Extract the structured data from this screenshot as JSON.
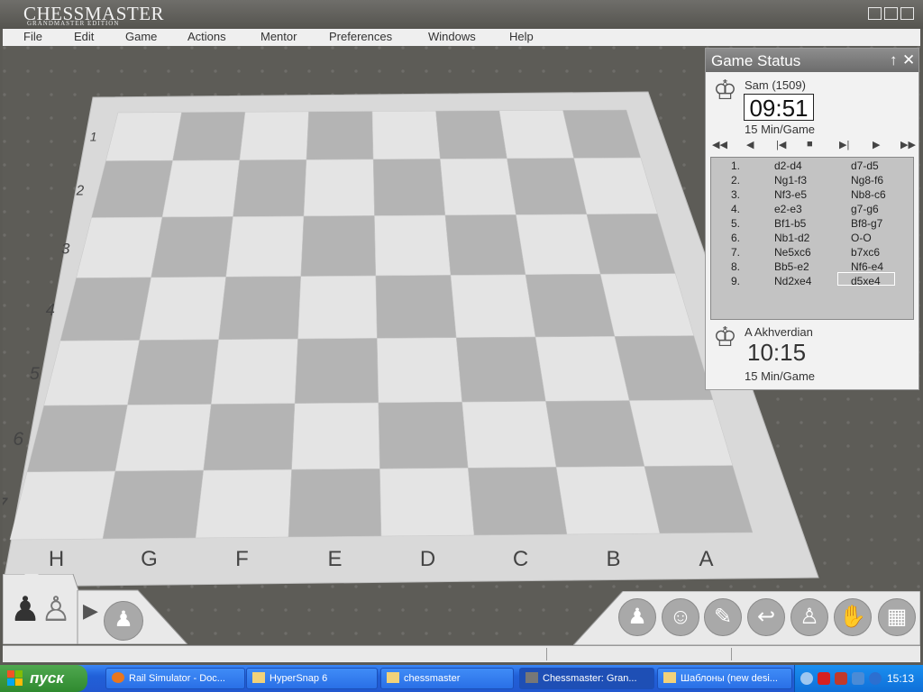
{
  "app": {
    "title": "CHESSMASTER",
    "subtitle": "GRANDMASTER EDITION"
  },
  "window_buttons": [
    "minimize-icon",
    "restore-icon",
    "close-icon"
  ],
  "menu": [
    "File",
    "Edit",
    "Game",
    "Actions",
    "Mentor",
    "Preferences",
    "Windows",
    "Help"
  ],
  "board": {
    "ranks": [
      "1",
      "2",
      "3",
      "4",
      "5",
      "6",
      "7"
    ],
    "files": [
      "H",
      "G",
      "F",
      "E",
      "D",
      "C",
      "B",
      "A"
    ]
  },
  "game_status": {
    "title": "Game Status",
    "player_top": {
      "name": "Sam (1509)",
      "clock": "09:51",
      "time_control": "15 Min/Game"
    },
    "player_bottom": {
      "name": "A Akhverdian",
      "clock": "10:15",
      "time_control": "15 Min/Game"
    },
    "nav_icons": [
      "first-move-icon",
      "prev-move-icon",
      "step-back-icon",
      "stop-icon",
      "step-forward-icon",
      "next-move-icon",
      "last-move-icon"
    ],
    "moves": [
      {
        "num": "1.",
        "white": "d2-d4",
        "black": "d7-d5"
      },
      {
        "num": "2.",
        "white": "Ng1-f3",
        "black": "Ng8-f6"
      },
      {
        "num": "3.",
        "white": "Nf3-e5",
        "black": "Nb8-c6"
      },
      {
        "num": "4.",
        "white": "e2-e3",
        "black": "g7-g6"
      },
      {
        "num": "5.",
        "white": "Bf1-b5",
        "black": "Bf8-g7"
      },
      {
        "num": "6.",
        "white": "Nb1-d2",
        "black": "O-O"
      },
      {
        "num": "7.",
        "white": "Ne5xc6",
        "black": "b7xc6"
      },
      {
        "num": "8.",
        "white": "Bb5-e2",
        "black": "Nf6-e4"
      },
      {
        "num": "9.",
        "white": "Nd2xe4",
        "black": "d5xe4"
      }
    ]
  },
  "taskbar": {
    "start": "пуск",
    "tasks": [
      "Rail Simulator - Doc...",
      "HyperSnap 6",
      "chessmaster",
      "Chessmaster: Gran...",
      "Шаблоны (new desi..."
    ],
    "time": "15:13"
  },
  "colors": {
    "board_light": "#e4e4e4",
    "board_dark": "#b4b4b4",
    "frame": "#d8d8d8",
    "taskbar": "#2558d6",
    "start": "#3b9b3b"
  }
}
